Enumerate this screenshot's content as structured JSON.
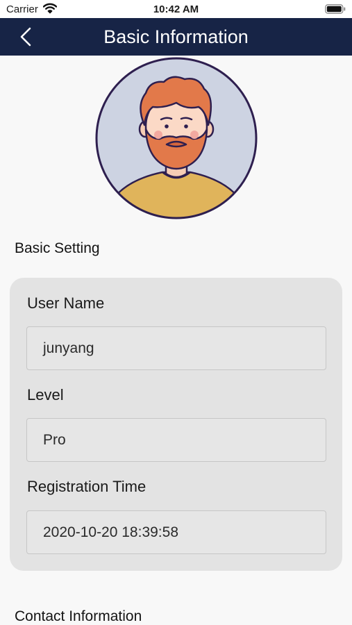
{
  "status_bar": {
    "carrier": "Carrier",
    "time": "10:42 AM"
  },
  "nav": {
    "title": "Basic Information"
  },
  "sections": {
    "basic_setting": "Basic Setting",
    "contact_information": "Contact Information"
  },
  "fields": [
    {
      "label": "User Name",
      "value": "junyang"
    },
    {
      "label": "Level",
      "value": "Pro"
    },
    {
      "label": "Registration Time",
      "value": "2020-10-20 18:39:58"
    }
  ],
  "icons": {
    "back": "chevron-left-icon",
    "wifi": "wifi-icon",
    "battery": "battery-icon"
  },
  "colors": {
    "nav_background": "#172446",
    "page_background": "#f8f8f8",
    "card_background": "#e3e3e3",
    "avatar_background": "#cdd3e2",
    "avatar_outline": "#2e1f4f"
  }
}
